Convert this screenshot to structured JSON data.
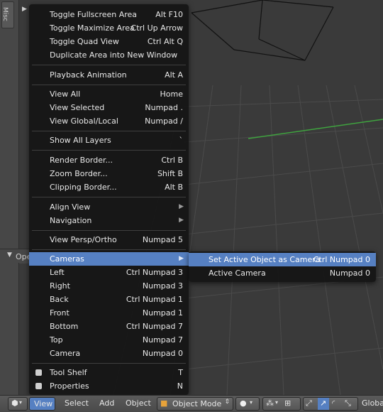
{
  "sidebar": {
    "tab_label": "Misc",
    "operator_panel_label": "Ope"
  },
  "view_menu": {
    "items": [
      {
        "label": "Toggle Fullscreen Area",
        "shortcut": "Alt F10"
      },
      {
        "label": "Toggle Maximize Area",
        "shortcut": "Ctrl Up Arrow"
      },
      {
        "label": "Toggle Quad View",
        "shortcut": "Ctrl Alt Q"
      },
      {
        "label": "Duplicate Area into New Window",
        "shortcut": ""
      },
      {
        "label": "Playback Animation",
        "shortcut": "Alt A"
      },
      {
        "label": "View All",
        "shortcut": "Home"
      },
      {
        "label": "View Selected",
        "shortcut": "Numpad ."
      },
      {
        "label": "View Global/Local",
        "shortcut": "Numpad /"
      },
      {
        "label": "Show All Layers",
        "shortcut": "`"
      },
      {
        "label": "Render Border...",
        "shortcut": "Ctrl B"
      },
      {
        "label": "Zoom Border...",
        "shortcut": "Shift B"
      },
      {
        "label": "Clipping Border...",
        "shortcut": "Alt B"
      },
      {
        "label": "Align View",
        "shortcut": ""
      },
      {
        "label": "Navigation",
        "shortcut": ""
      },
      {
        "label": "View Persp/Ortho",
        "shortcut": "Numpad 5"
      },
      {
        "label": "Cameras",
        "shortcut": ""
      },
      {
        "label": "Left",
        "shortcut": "Ctrl Numpad 3"
      },
      {
        "label": "Right",
        "shortcut": "Numpad 3"
      },
      {
        "label": "Back",
        "shortcut": "Ctrl Numpad 1"
      },
      {
        "label": "Front",
        "shortcut": "Numpad 1"
      },
      {
        "label": "Bottom",
        "shortcut": "Ctrl Numpad 7"
      },
      {
        "label": "Top",
        "shortcut": "Numpad 7"
      },
      {
        "label": "Camera",
        "shortcut": "Numpad 0"
      },
      {
        "label": "Tool Shelf",
        "shortcut": "T"
      },
      {
        "label": "Properties",
        "shortcut": "N"
      }
    ]
  },
  "cameras_submenu": {
    "items": [
      {
        "label": "Set Active Object as Camera",
        "shortcut": "Ctrl Numpad 0"
      },
      {
        "label": "Active Camera",
        "shortcut": "Numpad 0"
      }
    ]
  },
  "header": {
    "menus": [
      "View",
      "Select",
      "Add",
      "Object"
    ],
    "mode": "Object Mode",
    "orientation": "Global"
  },
  "colors": {
    "highlight": "#5680c2",
    "menu_bg": "#161616",
    "grid_x_axis": "#3fa33f"
  }
}
